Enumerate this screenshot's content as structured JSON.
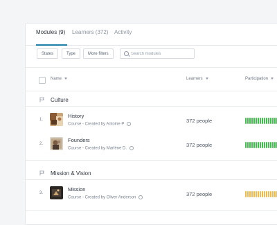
{
  "tabs": [
    {
      "label": "Modules (9)",
      "active": true
    },
    {
      "label": "Learners (372)",
      "active": false
    },
    {
      "label": "Activity",
      "active": false
    }
  ],
  "filters": {
    "states_label": "States",
    "type_label": "Type",
    "more_label": "More filters",
    "search_placeholder": "Search modules"
  },
  "table": {
    "headers": {
      "name": "Name",
      "learners": "Learners",
      "participation": "Participation"
    }
  },
  "groups": [
    {
      "title": "Culture",
      "rows": [
        {
          "num": "1.",
          "title": "History",
          "subtitle": "Course - Created by Antoine P",
          "learners": "372 people",
          "participation": 1.0,
          "color": "#3fbf4b"
        },
        {
          "num": "2.",
          "title": "Founders",
          "subtitle": "Course - Created by Marlène D.",
          "learners": "372 people",
          "participation": 1.0,
          "color": "#3fbf4b"
        }
      ]
    },
    {
      "title": "Mission & Vision",
      "rows": [
        {
          "num": "3.",
          "title": "Mission",
          "subtitle": "Course - Created by Oliver Anderson",
          "learners": "372 people",
          "participation": 1.0,
          "color": "#f0b94e"
        }
      ]
    }
  ],
  "colors": {
    "accent": "#1b7fa8",
    "bar_empty": "#e4e6ea"
  },
  "icons": {
    "group": "flag-icon",
    "search": "search-icon",
    "info": "info-icon",
    "sort": "caret-down-icon"
  }
}
